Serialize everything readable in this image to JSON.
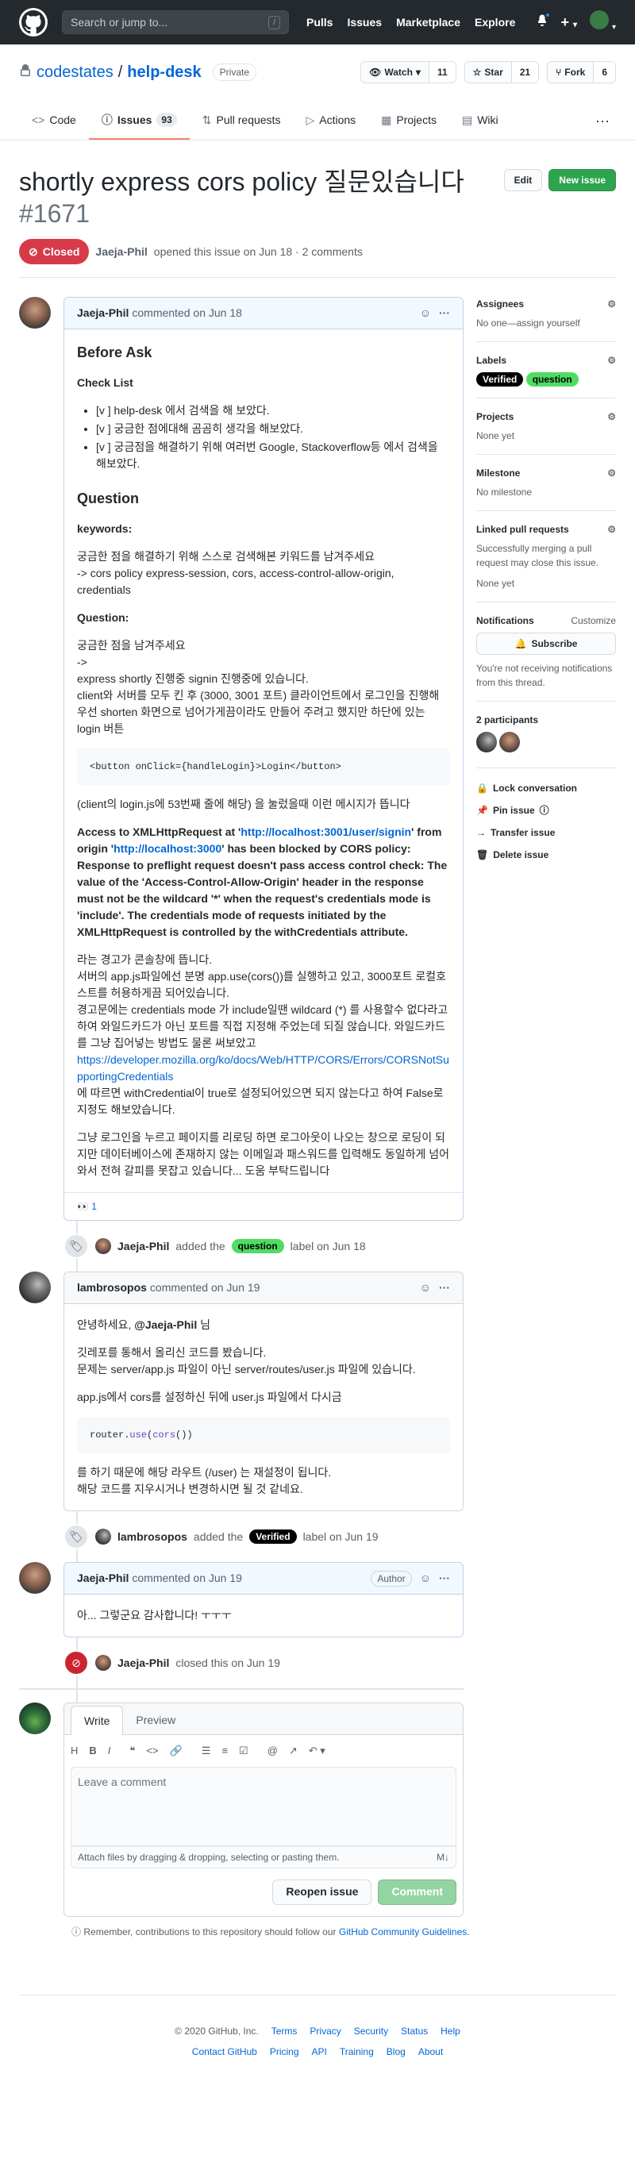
{
  "topbar": {
    "search_placeholder": "Search or jump to...",
    "slash_key": "/",
    "nav": [
      "Pulls",
      "Issues",
      "Marketplace",
      "Explore"
    ],
    "plus_label": "+"
  },
  "repo": {
    "owner": "codestates",
    "separator": "/",
    "name": "help-desk",
    "visibility": "Private",
    "watch_label": "Watch",
    "watch_count": "11",
    "star_label": "Star",
    "star_count": "21",
    "fork_label": "Fork",
    "fork_count": "6"
  },
  "tabs": [
    {
      "label": "Code",
      "icon": "code-icon"
    },
    {
      "label": "Issues",
      "icon": "issue-opened-icon",
      "count": "93"
    },
    {
      "label": "Pull requests",
      "icon": "git-pull-request-icon"
    },
    {
      "label": "Actions",
      "icon": "play-icon"
    },
    {
      "label": "Projects",
      "icon": "project-icon"
    },
    {
      "label": "Wiki",
      "icon": "book-icon"
    }
  ],
  "issue": {
    "title": "shortly express cors policy 질문있습니다",
    "number": "#1671",
    "edit_label": "Edit",
    "new_issue_label": "New issue",
    "state": "Closed",
    "author": "Jaeja-Phil",
    "meta_text": "opened this issue on Jun 18 · 2 comments"
  },
  "comment1": {
    "author": "Jaeja-Phil",
    "meta": "commented on Jun 18",
    "h_before": "Before Ask",
    "h_checklist": "Check List",
    "checklist": [
      "[v ] help-desk 에서 검색을 해 보았다.",
      "[v ] 궁금한 점에대해 곰곰히 생각을 해보았다.",
      "[v ] 궁금점을 해결하기 위해 여러번 Google, Stackoverflow등 에서 검색을 해보았다."
    ],
    "h_question": "Question",
    "h_keywords": "keywords:",
    "keywords_line1": "궁금한 점을 해결하기 위해 스스로 검색해본 키워드를 남겨주세요",
    "keywords_line2": "-> cors policy express-session, cors, access-control-allow-origin, credentials",
    "h_question2": "Question:",
    "q_line1": "궁금한 점을 남겨주세요",
    "q_line2": "->",
    "q_line3": "express shortly 진행중 signin 진행중에 있습니다.",
    "q_line4": "client와 서버를 모두 킨 후 (3000, 3001 포트) 클라이언트에서 로그인을 진행해 우선 shorten 화면으로 넘어가게끔이라도 만들어 주려고 했지만 하단에 있는 login 버튼",
    "code1": "<button onClick={handleLogin}>Login</button>",
    "after_code": "(client의 login.js에 53번째 줄에 해당) 을 눌렀을때 이런 메시지가 뜹니다",
    "error_a": "Access to XMLHttpRequest at '",
    "error_url1": "http://localhost:3001/user/signin",
    "error_b": "' from origin '",
    "error_url2": "http://localhost:3000",
    "error_c": "' has been blocked by CORS policy: Response to preflight request doesn't pass access control check: The value of the 'Access-Control-Allow-Origin' header in the response must not be the wildcard '*' when the request's credentials mode is 'include'. The credentials mode of requests initiated by the XMLHttpRequest is controlled by the withCredentials attribute.",
    "p_line1": "라는 경고가 콘솔창에 뜹니다.",
    "p_line2": "서버의 app.js파일에선 분명 app.use(cors())를 실행하고 있고, 3000포트 로컬호스트를 허용하게끔 되어있습니다.",
    "p_line3": "경고문에는 credentials mode 가 include일땐 wildcard (*) 를 사용할수 없다라고 하여 와일드카드가 아닌 포트를 직접 지정해 주었는데 되질 않습니다. 와일드카드를 그냥 집어넣는 방법도 물론 써보았고",
    "p_link": "https://developer.mozilla.org/ko/docs/Web/HTTP/CORS/Errors/CORSNotSupportingCredentials",
    "p_line4": "에 따르면 withCredential이 true로 설정되어있으면 되지 않는다고 하여 False로 지정도 해보았습니다.",
    "p_last": "그냥 로그인을 누르고 페이지를 리로딩 하면 로그아웃이 나오는 창으로 로딩이 되지만 데이터베이스에 존재하지 않는 이메일과 패스워드를 입력해도 동일하게 넘어와서 전혀 갈피를 못잡고 있습니다... 도움 부탁드립니다",
    "reaction_emoji": "👀",
    "reaction_count": "1"
  },
  "event1": {
    "actor": "Jaeja-Phil",
    "pre": "added the",
    "label": "question",
    "post": "label on Jun 18"
  },
  "comment2": {
    "author": "lambrosopos",
    "meta": "commented on Jun 19",
    "greet_a": "안녕하세요,",
    "greet_mention": "@Jaeja-Phil",
    "greet_b": "님",
    "line1": "깃레포를 통해서 올리신 코드를 봤습니다.",
    "line2": "문제는 server/app.js 파일이 아닌 server/routes/user.js 파일에 있습니다.",
    "line3": "app.js에서 cors를 설정하신 뒤에 user.js 파일에서 다시금",
    "code_a": "router.",
    "code_b": "use",
    "code_c": "(",
    "code_d": "cors",
    "code_e": "())",
    "line4": "를 하기 때문에 해당 라우트 (/user) 는 재설정이 됩니다.",
    "line5": "해당 코드를 지우시거나 변경하시면 될 것 같네요."
  },
  "event2": {
    "actor": "lambrosopos",
    "pre": "added the",
    "label": "Verified",
    "post": "label on Jun 19"
  },
  "comment3": {
    "author": "Jaeja-Phil",
    "meta": "commented on Jun 19",
    "badge": "Author",
    "body": "아... 그렇군요 감사합니다! ㅜㅜㅜ"
  },
  "event3": {
    "actor": "Jaeja-Phil",
    "text": "closed this on Jun 19"
  },
  "editor": {
    "tab_write": "Write",
    "tab_preview": "Preview",
    "placeholder": "Leave a comment",
    "attach_text": "Attach files by dragging & dropping, selecting or pasting them.",
    "reopen_label": "Reopen issue",
    "comment_label": "Comment"
  },
  "remember": {
    "text": "Remember, contributions to this repository should follow our",
    "link": "GitHub Community Guidelines",
    "end": "."
  },
  "sidebar": {
    "assignees_h": "Assignees",
    "assignees_v": "No one—assign yourself",
    "labels_h": "Labels",
    "labels": [
      "Verified",
      "question"
    ],
    "projects_h": "Projects",
    "projects_v": "None yet",
    "milestone_h": "Milestone",
    "milestone_v": "No milestone",
    "linked_h": "Linked pull requests",
    "linked_desc": "Successfully merging a pull request may close this issue.",
    "linked_v": "None yet",
    "notif_h": "Notifications",
    "notif_customize": "Customize",
    "subscribe_label": "Subscribe",
    "notif_desc": "You're not receiving notifications from this thread.",
    "participants_h": "2 participants",
    "lock": "Lock conversation",
    "pin": "Pin issue",
    "transfer": "Transfer issue",
    "delete": "Delete issue"
  },
  "footer": {
    "copyright": "© 2020 GitHub, Inc.",
    "row1": [
      "Terms",
      "Privacy",
      "Security",
      "Status",
      "Help"
    ],
    "row2": [
      "Contact GitHub",
      "Pricing",
      "API",
      "Training",
      "Blog",
      "About"
    ]
  }
}
